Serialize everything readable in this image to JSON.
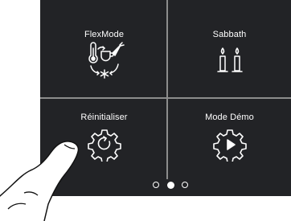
{
  "tiles": [
    {
      "label": "FlexMode",
      "icon": "flexmode-icon"
    },
    {
      "label": "Sabbath",
      "icon": "sabbath-candles-icon"
    },
    {
      "label": "Réinitialiser",
      "icon": "reset-gear-icon"
    },
    {
      "label": "Mode Démo",
      "icon": "demo-play-gear-icon"
    }
  ],
  "pager": {
    "pages": 3,
    "active": 2
  },
  "colors": {
    "panel": "#222326",
    "divider": "#8c8c8c",
    "text": "#ffffff"
  }
}
